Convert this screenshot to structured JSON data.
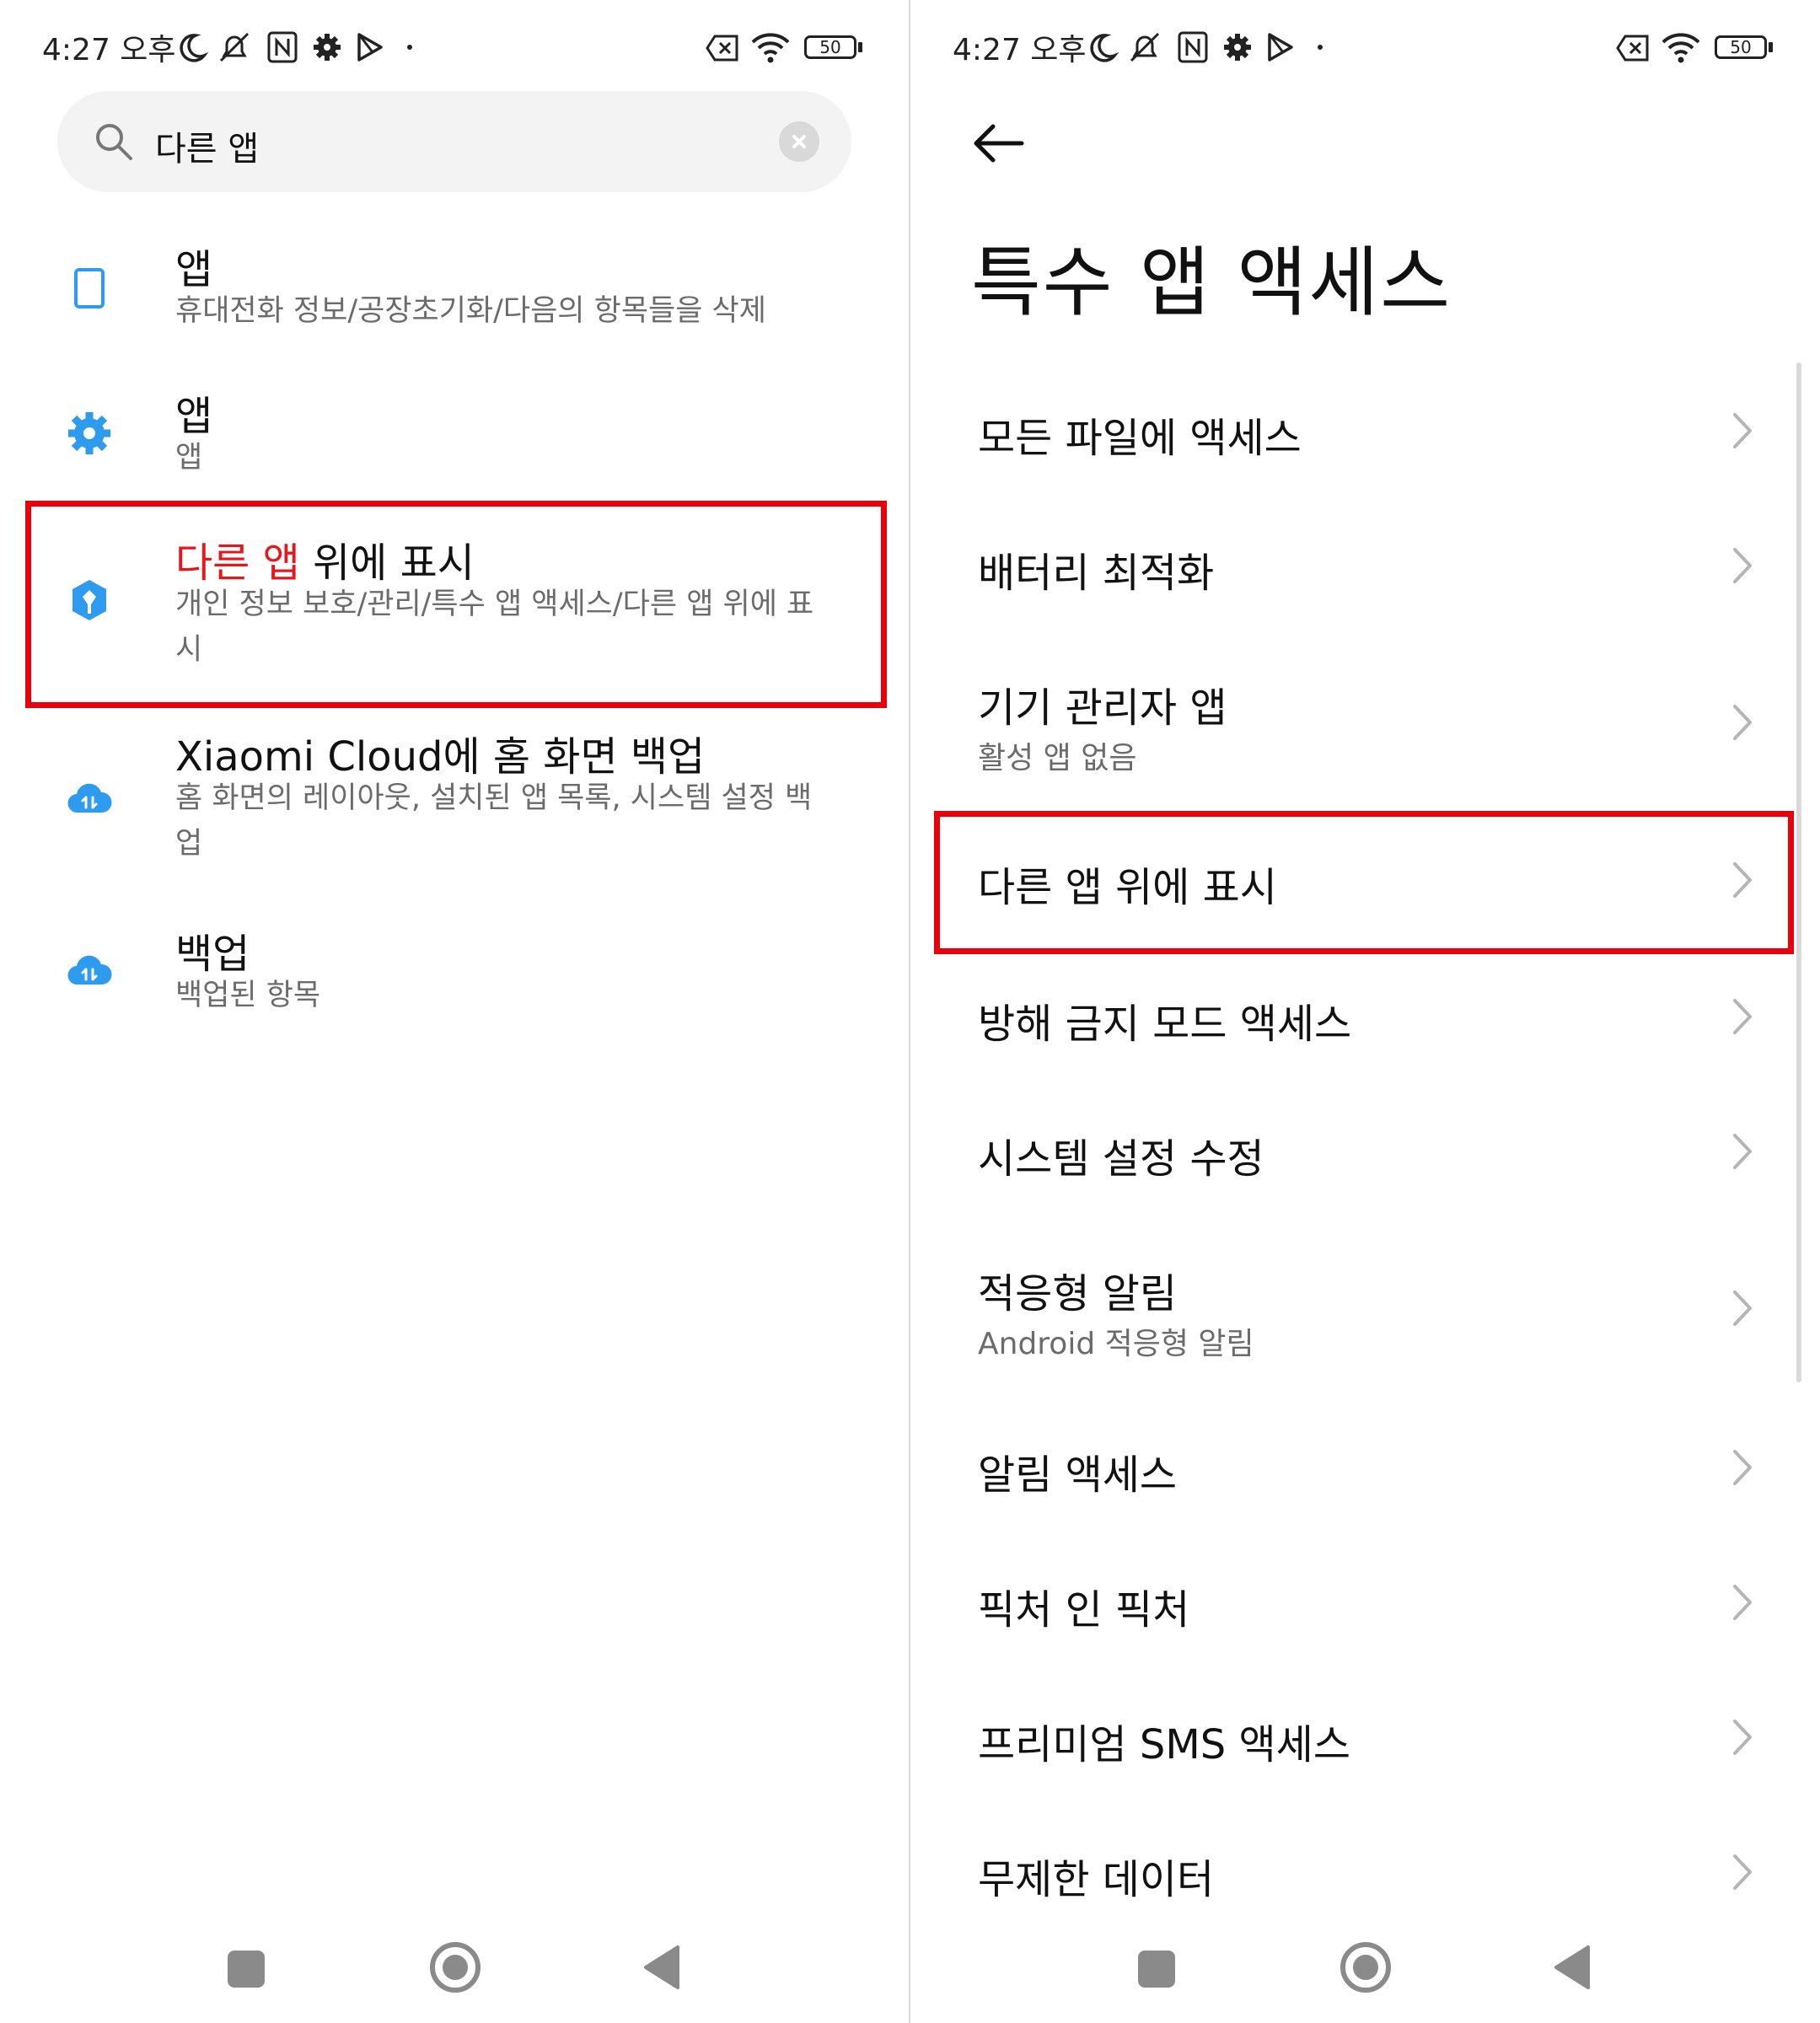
{
  "status_bar": {
    "time": "4:27 오후",
    "battery": "50"
  },
  "left": {
    "search": {
      "query": "다른 앱"
    },
    "results": [
      {
        "title_highlight": "",
        "title_rest": "앱",
        "subtitle": "휴대전화 정보/공장초기화/다음의 항목들을 삭제",
        "icon": "phone-outline-icon"
      },
      {
        "title_highlight": "",
        "title_rest": "앱",
        "subtitle": "앱",
        "icon": "settings-gear-icon"
      },
      {
        "title_highlight": "다른 앱",
        "title_rest": " 위에 표시",
        "subtitle": "개인 정보 보호/관리/특수 앱 액세스/다른 앱 위에 표시",
        "icon": "privacy-shield-icon"
      },
      {
        "title_highlight": "",
        "title_rest": "Xiaomi Cloud에 홈 화면 백업",
        "subtitle": "홈 화면의 레이아웃, 설치된 앱 목록, 시스템 설정 백업",
        "icon": "cloud-sync-icon"
      },
      {
        "title_highlight": "",
        "title_rest": "백업",
        "subtitle": "백업된 항목",
        "icon": "cloud-sync-icon"
      }
    ]
  },
  "right": {
    "title": "특수 앱 액세스",
    "items": [
      {
        "label": "모든 파일에 액세스",
        "sub": ""
      },
      {
        "label": "배터리 최적화",
        "sub": ""
      },
      {
        "label": "기기 관리자 앱",
        "sub": "활성 앱 없음"
      },
      {
        "label": "다른 앱 위에 표시",
        "sub": ""
      },
      {
        "label": "방해 금지 모드 액세스",
        "sub": ""
      },
      {
        "label": "시스템 설정 수정",
        "sub": ""
      },
      {
        "label": "적응형 알림",
        "sub": "Android 적응형 알림"
      },
      {
        "label": "알림 액세스",
        "sub": ""
      },
      {
        "label": "픽처 인 픽처",
        "sub": ""
      },
      {
        "label": "프리미엄 SMS 액세스",
        "sub": ""
      },
      {
        "label": "무제한 데이터",
        "sub": ""
      }
    ]
  },
  "colors": {
    "highlight_red": "#e5161c",
    "icon_blue": "#2e9bef",
    "box_red": "#e8000b"
  }
}
